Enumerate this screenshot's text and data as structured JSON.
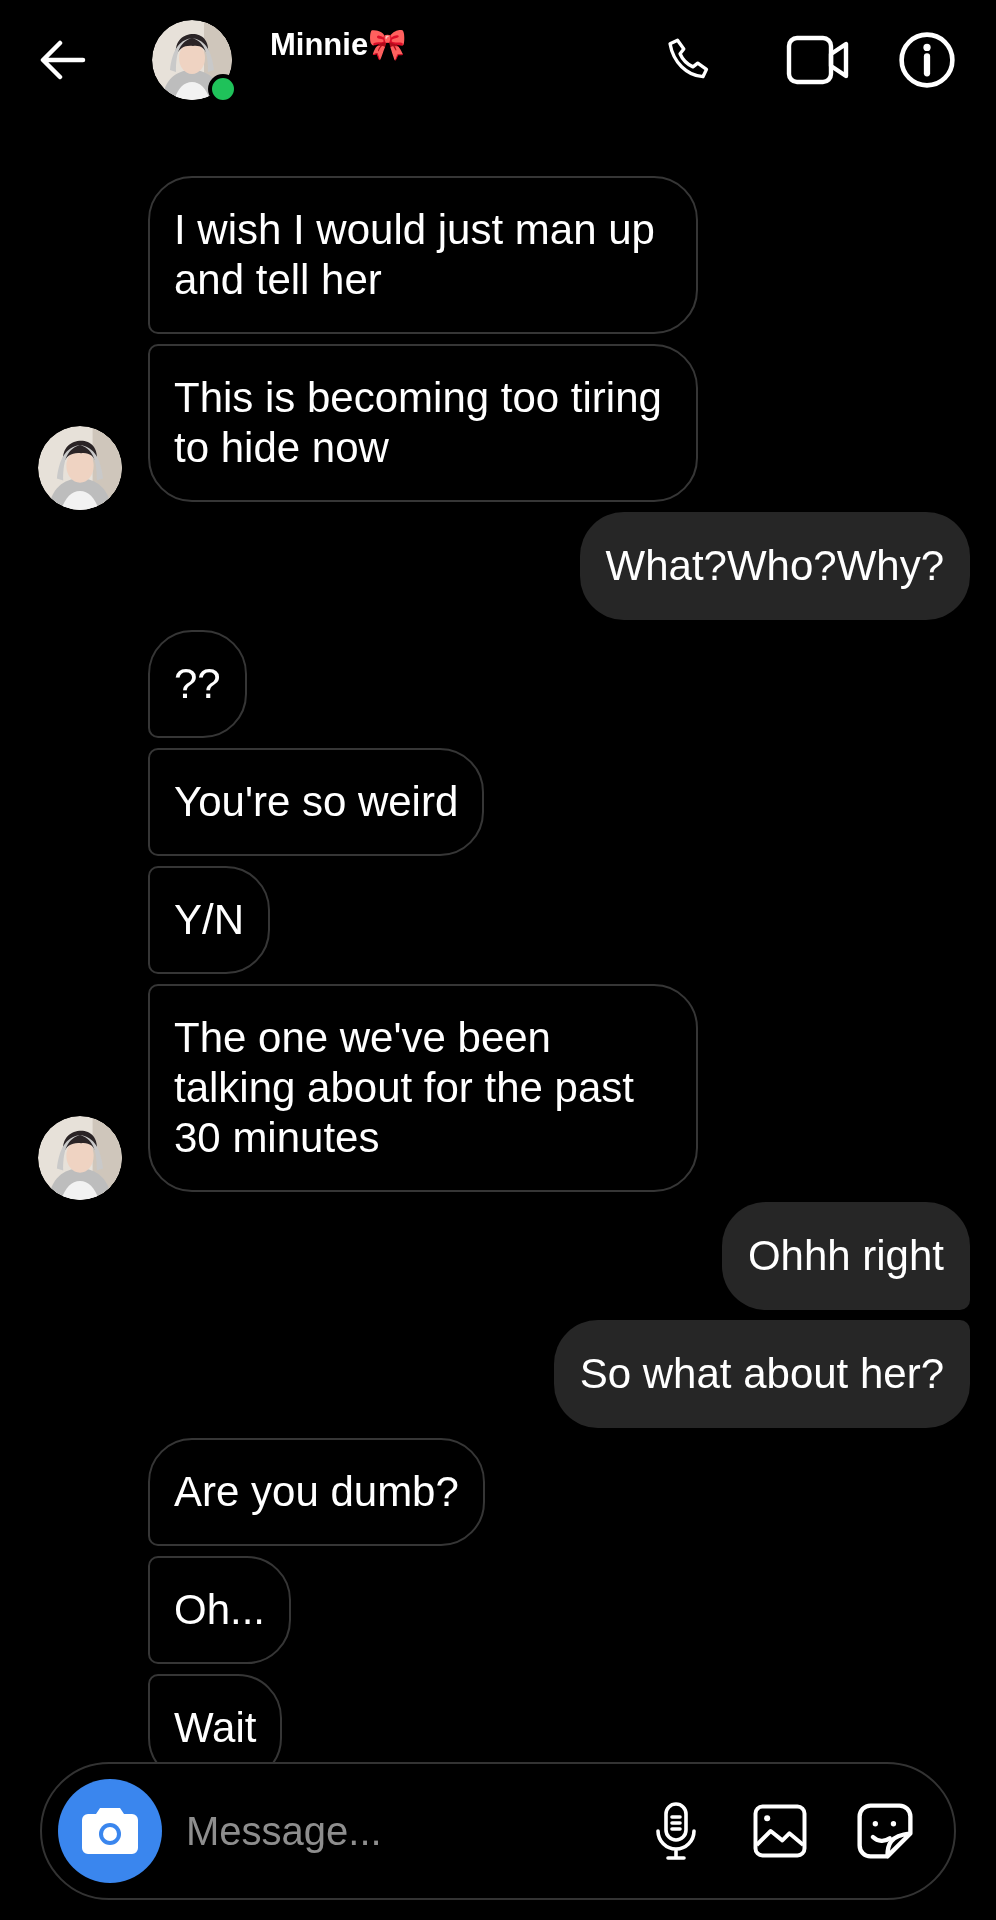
{
  "header": {
    "name": "Minnie🎀",
    "online": true
  },
  "messages": [
    {
      "kind": "them",
      "text": "I wish I would just man up and tell her",
      "show_avatar": false
    },
    {
      "kind": "them",
      "text": "This is becoming too tiring to hide now",
      "show_avatar": true
    },
    {
      "kind": "me",
      "text": "What?Who?Why?"
    },
    {
      "kind": "them",
      "text": "??",
      "show_avatar": false
    },
    {
      "kind": "them",
      "text": "You're so weird",
      "show_avatar": false
    },
    {
      "kind": "them",
      "text": "Y/N",
      "show_avatar": false
    },
    {
      "kind": "them",
      "text": "The one we've been talking about for the past 30 minutes",
      "show_avatar": true
    },
    {
      "kind": "me",
      "text": "Ohhh right"
    },
    {
      "kind": "me",
      "text": "So what about her?"
    },
    {
      "kind": "them",
      "text": "Are you dumb?",
      "show_avatar": false
    },
    {
      "kind": "them",
      "text": "Oh...",
      "show_avatar": false
    },
    {
      "kind": "them",
      "text": "Wait",
      "show_avatar": false
    }
  ],
  "composer": {
    "placeholder": "Message..."
  }
}
